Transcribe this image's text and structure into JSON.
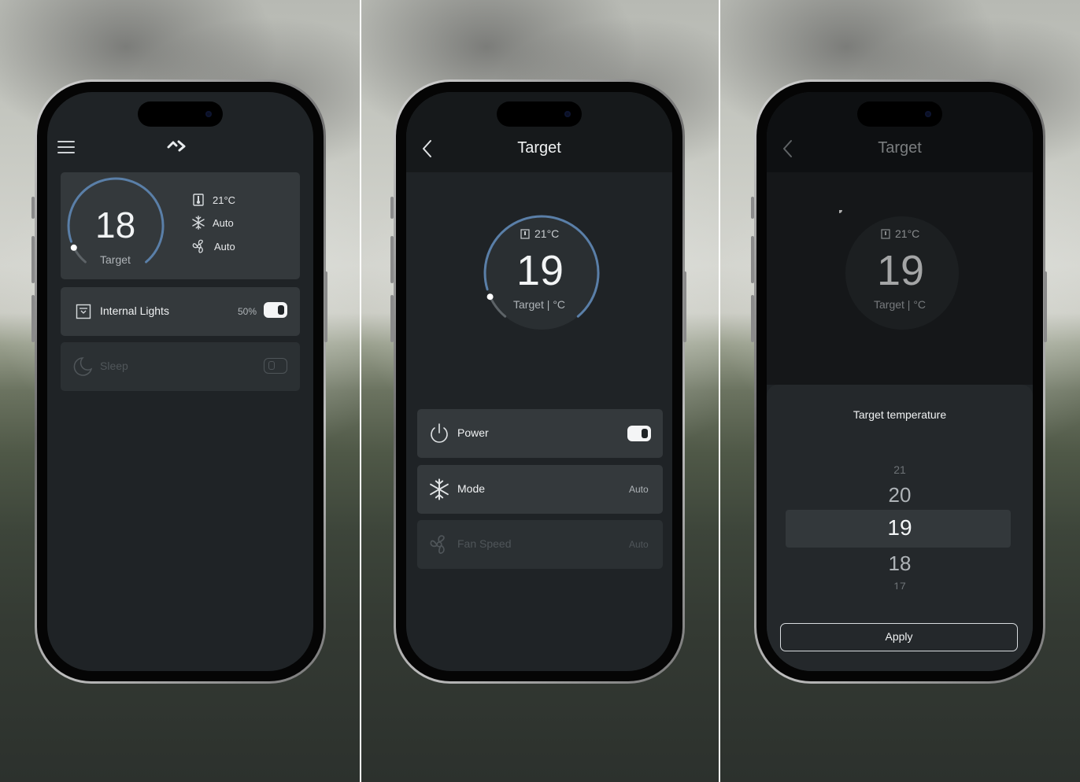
{
  "screens": {
    "home": {
      "target_value": "18",
      "target_label": "Target",
      "dial_fraction": 0.4,
      "info": [
        {
          "icon": "thermometer-icon",
          "text": "21°C"
        },
        {
          "icon": "snowflake-icon",
          "text": "Auto"
        },
        {
          "icon": "fan-icon",
          "text": "Auto"
        }
      ],
      "lights": {
        "label": "Internal Lights",
        "value": "50%",
        "on": true
      },
      "sleep": {
        "label": "Sleep",
        "on": false
      }
    },
    "target": {
      "title": "Target",
      "current": "21°C",
      "value": "19",
      "label": "Target | °C",
      "dial_fraction": 0.45,
      "rows": {
        "power": {
          "label": "Power",
          "on": true
        },
        "mode": {
          "label": "Mode",
          "value": "Auto"
        },
        "fan": {
          "label": "Fan Speed",
          "value": "Auto"
        }
      }
    },
    "picker": {
      "title": "Target",
      "current": "21°C",
      "value": "19",
      "label": "Target | °C",
      "sheet_title": "Target temperature",
      "options": [
        "21",
        "20",
        "19",
        "18",
        "17"
      ],
      "selected": "19",
      "apply_label": "Apply"
    }
  },
  "colors": {
    "screen": "#1f2326",
    "card": "#34393c",
    "accent_arc": "#5a7fa8",
    "text": "#f0f2f3"
  }
}
